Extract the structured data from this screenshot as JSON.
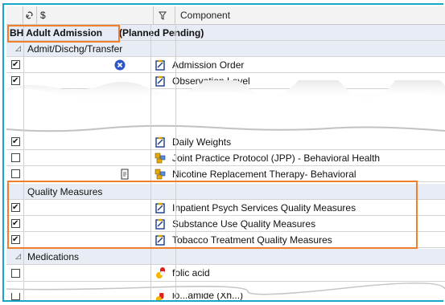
{
  "header": {
    "col_dollar": "$",
    "col_component": "Component"
  },
  "plan_title": {
    "name": "BH Adult Admission",
    "status": "(Planned Pending)"
  },
  "sections": {
    "admit": {
      "label": "Admit/Dischg/Transfer"
    },
    "quality": {
      "label": "Quality Measures"
    },
    "medications": {
      "label": "Medications"
    }
  },
  "rows": {
    "admission_order": {
      "label": "Admission Order",
      "checked": true
    },
    "observation_level": {
      "label": "Observation Level",
      "checked": true
    },
    "daily_weights": {
      "label": "Daily Weights",
      "checked": true
    },
    "jpp": {
      "label": "Joint Practice Protocol (JPP) - Behavioral Health",
      "checked": false
    },
    "nicotine": {
      "label": "Nicotine Replacement Therapy- Behavioral",
      "checked": false
    },
    "inpatient_psych": {
      "label": "Inpatient Psych Services Quality Measures",
      "checked": true
    },
    "substance_use": {
      "label": "Substance Use Quality Measures",
      "checked": true
    },
    "tobacco": {
      "label": "Tobacco Treatment Quality Measures",
      "checked": true
    },
    "folic_acid": {
      "label": "folic acid",
      "checked": false
    },
    "partial_bottom": {
      "label": "lo...amide (Xh...)",
      "checked": false
    }
  },
  "colors": {
    "highlight_orange": "#ef7f2a",
    "window_border": "#17a6c7",
    "group_bg": "#e8ecf4",
    "x_icon_blue": "#2d55c8"
  },
  "icons": {
    "orders": "clipboard-order-icon",
    "protocol": "multi-phase-plan-icon",
    "note": "note-doc-icon",
    "medication": "pill-capsule-icon",
    "cancel": "blue-x-circle-icon",
    "filter": "flag-filter-icon",
    "link": "link-icon"
  }
}
